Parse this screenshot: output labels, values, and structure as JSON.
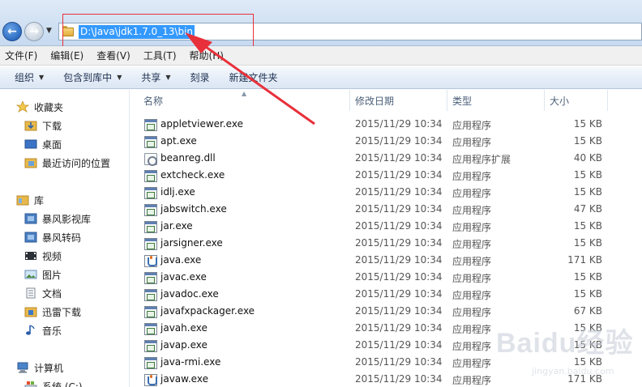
{
  "address": {
    "path": "D:\\Java\\jdk1.7.0_13\\bin"
  },
  "menu": {
    "file": "文件(F)",
    "edit": "编辑(E)",
    "view": "查看(V)",
    "tools": "工具(T)",
    "help": "帮助(H)"
  },
  "toolbar": {
    "organize": "组织",
    "include_in_library": "包含到库中",
    "share": "共享",
    "burn": "刻录",
    "new_folder": "新建文件夹"
  },
  "sidebar": {
    "favorites": "收藏夹",
    "downloads": "下载",
    "desktop": "桌面",
    "recent_places": "最近访问的位置",
    "libraries": "库",
    "storm_video_lib": "暴风影视库",
    "storm_convert": "暴风转码",
    "videos": "视频",
    "pictures": "图片",
    "documents": "文档",
    "thunder_download": "迅雷下载",
    "music": "音乐",
    "computer": "计算机",
    "system_drive": "系统 (C:)"
  },
  "columns": {
    "name": "名称",
    "modified": "修改日期",
    "type": "类型",
    "size": "大小"
  },
  "files": [
    {
      "name": "appletviewer.exe",
      "date": "2015/11/29 10:34",
      "type": "应用程序",
      "size": "15 KB",
      "icon": "exe-icon"
    },
    {
      "name": "apt.exe",
      "date": "2015/11/29 10:34",
      "type": "应用程序",
      "size": "15 KB",
      "icon": "exe-icon"
    },
    {
      "name": "beanreg.dll",
      "date": "2015/11/29 10:34",
      "type": "应用程序扩展",
      "size": "40 KB",
      "icon": "dll-icon"
    },
    {
      "name": "extcheck.exe",
      "date": "2015/11/29 10:34",
      "type": "应用程序",
      "size": "15 KB",
      "icon": "exe-icon"
    },
    {
      "name": "idlj.exe",
      "date": "2015/11/29 10:34",
      "type": "应用程序",
      "size": "15 KB",
      "icon": "exe-icon"
    },
    {
      "name": "jabswitch.exe",
      "date": "2015/11/29 10:34",
      "type": "应用程序",
      "size": "47 KB",
      "icon": "exe-icon"
    },
    {
      "name": "jar.exe",
      "date": "2015/11/29 10:34",
      "type": "应用程序",
      "size": "15 KB",
      "icon": "exe-icon"
    },
    {
      "name": "jarsigner.exe",
      "date": "2015/11/29 10:34",
      "type": "应用程序",
      "size": "15 KB",
      "icon": "exe-icon"
    },
    {
      "name": "java.exe",
      "date": "2015/11/29 10:34",
      "type": "应用程序",
      "size": "171 KB",
      "icon": "java-icon"
    },
    {
      "name": "javac.exe",
      "date": "2015/11/29 10:34",
      "type": "应用程序",
      "size": "15 KB",
      "icon": "exe-icon"
    },
    {
      "name": "javadoc.exe",
      "date": "2015/11/29 10:34",
      "type": "应用程序",
      "size": "15 KB",
      "icon": "exe-icon"
    },
    {
      "name": "javafxpackager.exe",
      "date": "2015/11/29 10:34",
      "type": "应用程序",
      "size": "67 KB",
      "icon": "exe-icon"
    },
    {
      "name": "javah.exe",
      "date": "2015/11/29 10:34",
      "type": "应用程序",
      "size": "15 KB",
      "icon": "exe-icon"
    },
    {
      "name": "javap.exe",
      "date": "2015/11/29 10:34",
      "type": "应用程序",
      "size": "15 KB",
      "icon": "exe-icon"
    },
    {
      "name": "java-rmi.exe",
      "date": "2015/11/29 10:34",
      "type": "应用程序",
      "size": "15 KB",
      "icon": "exe-icon"
    },
    {
      "name": "javaw.exe",
      "date": "2015/11/29 10:34",
      "type": "应用程序",
      "size": "171 KB",
      "icon": "java-icon"
    }
  ],
  "watermark": {
    "brand": "Baidu经验",
    "url": "jingyan.baidu.com"
  },
  "annotation": {
    "color": "#e8303a"
  }
}
